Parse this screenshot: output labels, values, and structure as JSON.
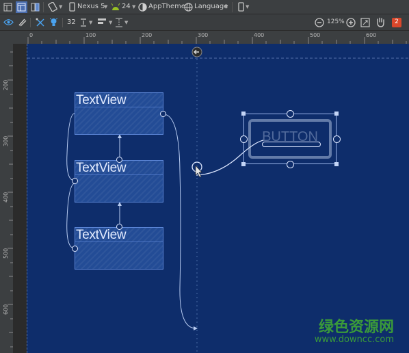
{
  "toolbar1": {
    "device": "Nexus 5",
    "api": "24",
    "theme": "AppTheme",
    "language": "Language"
  },
  "toolbar2": {
    "margin": "32",
    "zoom": "125%",
    "error_count": "2"
  },
  "ruler": {
    "top": [
      "0",
      "100",
      "200",
      "300",
      "400",
      "500",
      "600"
    ],
    "left": [
      "200",
      "300",
      "400",
      "500",
      "600"
    ]
  },
  "canvas": {
    "textview1": "TextView",
    "textview2": "TextView",
    "textview3": "TextView",
    "button": "BUTTON"
  },
  "watermark": {
    "title": "绿色资源网",
    "url": "www.downcc.com"
  },
  "colors": {
    "canvas_bg": "#0e2d6b",
    "widget_fill": "#234c96",
    "widget_border": "#5b85d6",
    "error_badge": "#d9472b"
  }
}
